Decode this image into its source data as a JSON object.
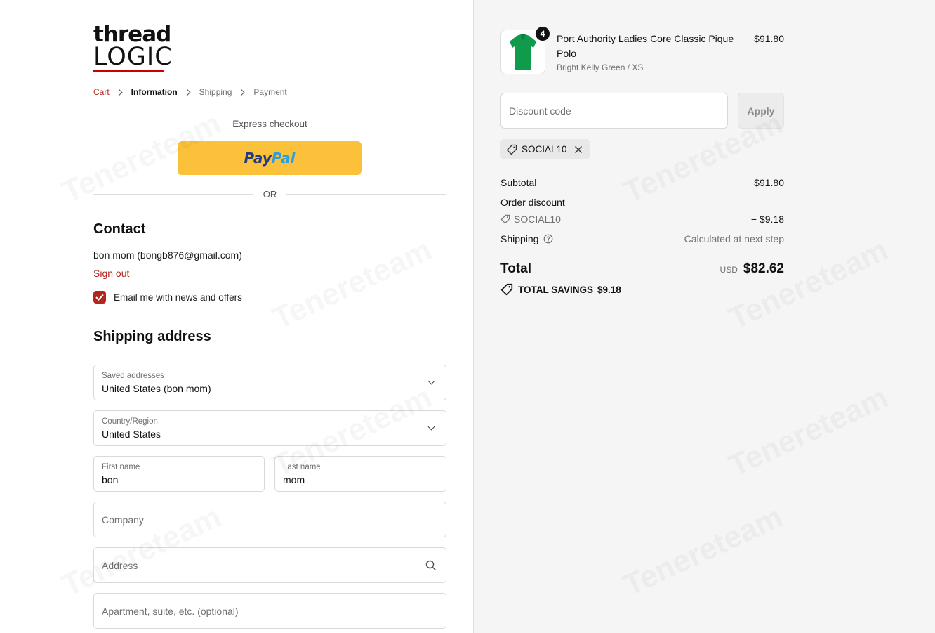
{
  "brand": {
    "logo_top": "thread",
    "logo_bottom": "LOGIC",
    "accent": "#b3261e"
  },
  "breadcrumb": {
    "items": [
      "Cart",
      "Information",
      "Shipping",
      "Payment"
    ]
  },
  "express": {
    "label": "Express checkout",
    "paypal_a": "Pay",
    "paypal_b": "Pal",
    "or": "OR"
  },
  "contact": {
    "title": "Contact",
    "email": "bon mom (bongb876@gmail.com)",
    "sign_out": "Sign out",
    "newsletter_label": "Email me with news and offers",
    "newsletter_checked": true
  },
  "shipping": {
    "title": "Shipping address",
    "saved_label": "Saved addresses",
    "saved_value": "United States (bon mom)",
    "country_label": "Country/Region",
    "country_value": "United States",
    "first_label": "First name",
    "first_value": "bon",
    "last_label": "Last name",
    "last_value": "mom",
    "company_ph": "Company",
    "address_ph": "Address",
    "apartment_ph": "Apartment, suite, etc. (optional)"
  },
  "order": {
    "product_name": "Port Authority Ladies Core Classic Pique Polo",
    "variant": "Bright Kelly Green / XS",
    "quantity": "4",
    "price": "$91.80",
    "discount_placeholder": "Discount code",
    "apply_label": "Apply",
    "applied_code": "SOCIAL10",
    "subtotal_label": "Subtotal",
    "subtotal_value": "$91.80",
    "order_discount_label": "Order discount",
    "discount_code": "SOCIAL10",
    "discount_value": "− $9.18",
    "shipping_label": "Shipping",
    "shipping_value": "Calculated at next step",
    "total_label": "Total",
    "currency": "USD",
    "total_value": "$82.62",
    "savings_label": "TOTAL SAVINGS",
    "savings_value": "$9.18"
  },
  "watermark_text": "Tenereteam"
}
